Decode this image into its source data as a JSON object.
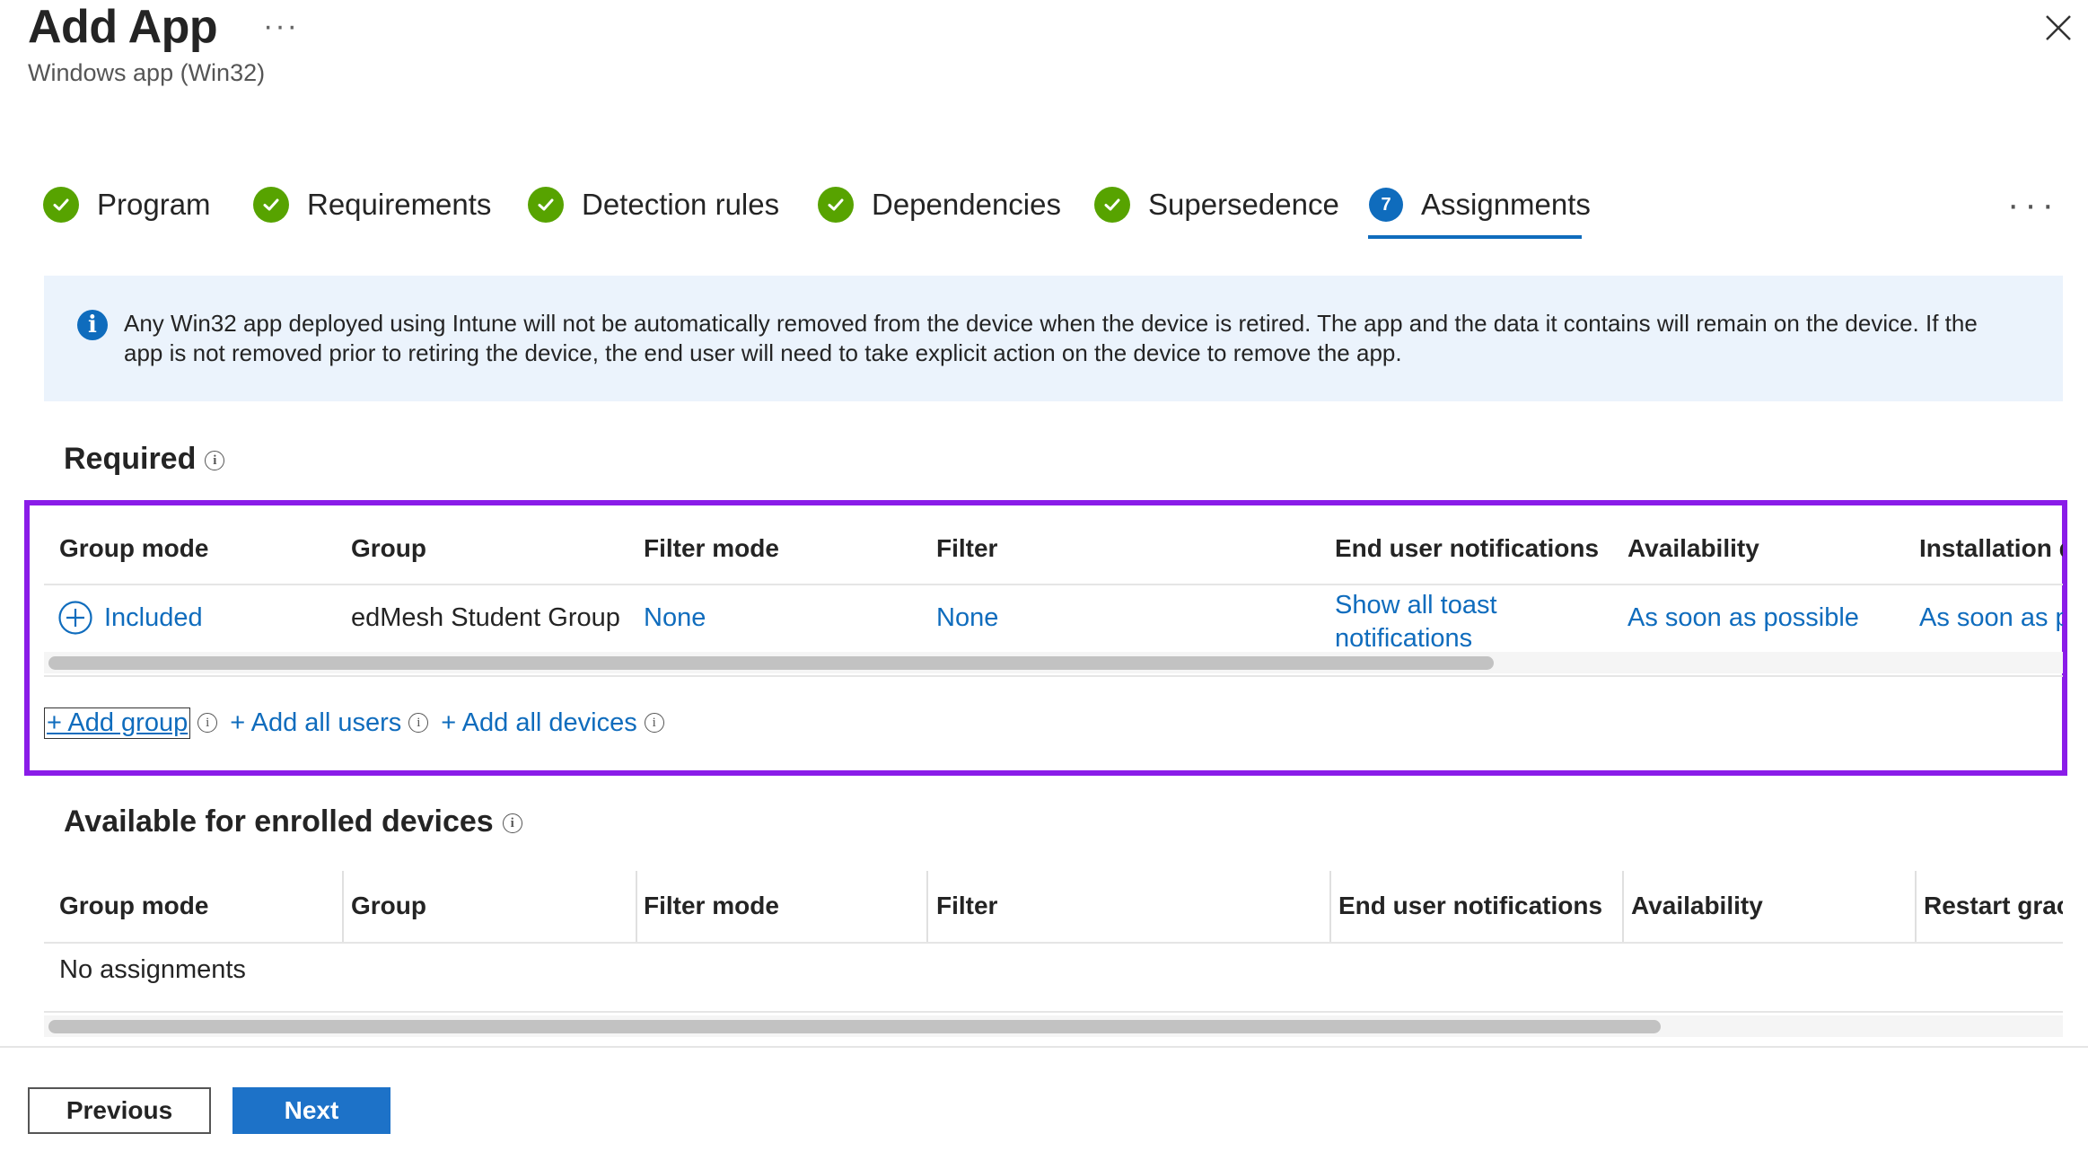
{
  "header": {
    "title": "Add App",
    "more": "···",
    "subtitle": "Windows app (Win32)"
  },
  "steps": [
    {
      "label": "Program",
      "status": "done"
    },
    {
      "label": "Requirements",
      "status": "done"
    },
    {
      "label": "Detection rules",
      "status": "done"
    },
    {
      "label": "Dependencies",
      "status": "done"
    },
    {
      "label": "Supersedence",
      "status": "done"
    },
    {
      "label": "Assignments",
      "status": "active",
      "number": "7"
    }
  ],
  "info": {
    "text": "Any Win32 app deployed using Intune will not be automatically removed from the device when the device is retired. The app and the data it contains will remain on the device. If the app is not removed prior to retiring the device, the end user will need to take explicit action on the device to remove the app."
  },
  "required": {
    "title": "Required",
    "columns": [
      "Group mode",
      "Group",
      "Filter mode",
      "Filter",
      "End user notifications",
      "Availability",
      "Installation d"
    ],
    "row": {
      "group_mode": "Included",
      "group": "edMesh Student Group",
      "filter_mode": "None",
      "filter": "None",
      "notifications_line1": "Show all toast",
      "notifications_line2": "notifications",
      "availability": "As soon as possible",
      "installation": "As soon as p"
    },
    "actions": {
      "add_group": "+ Add group",
      "add_all_users": "+ Add all users",
      "add_all_devices": "+ Add all devices"
    }
  },
  "available": {
    "title": "Available for enrolled devices",
    "columns": [
      "Group mode",
      "Group",
      "Filter mode",
      "Filter",
      "End user notifications",
      "Availability",
      "Restart grac"
    ],
    "empty": "No assignments"
  },
  "footer": {
    "previous": "Previous",
    "next": "Next"
  },
  "colors": {
    "accent": "#0f6cbd",
    "success": "#57a300",
    "highlight": "#8a1ce8",
    "info_bg": "#ebf3fc"
  }
}
